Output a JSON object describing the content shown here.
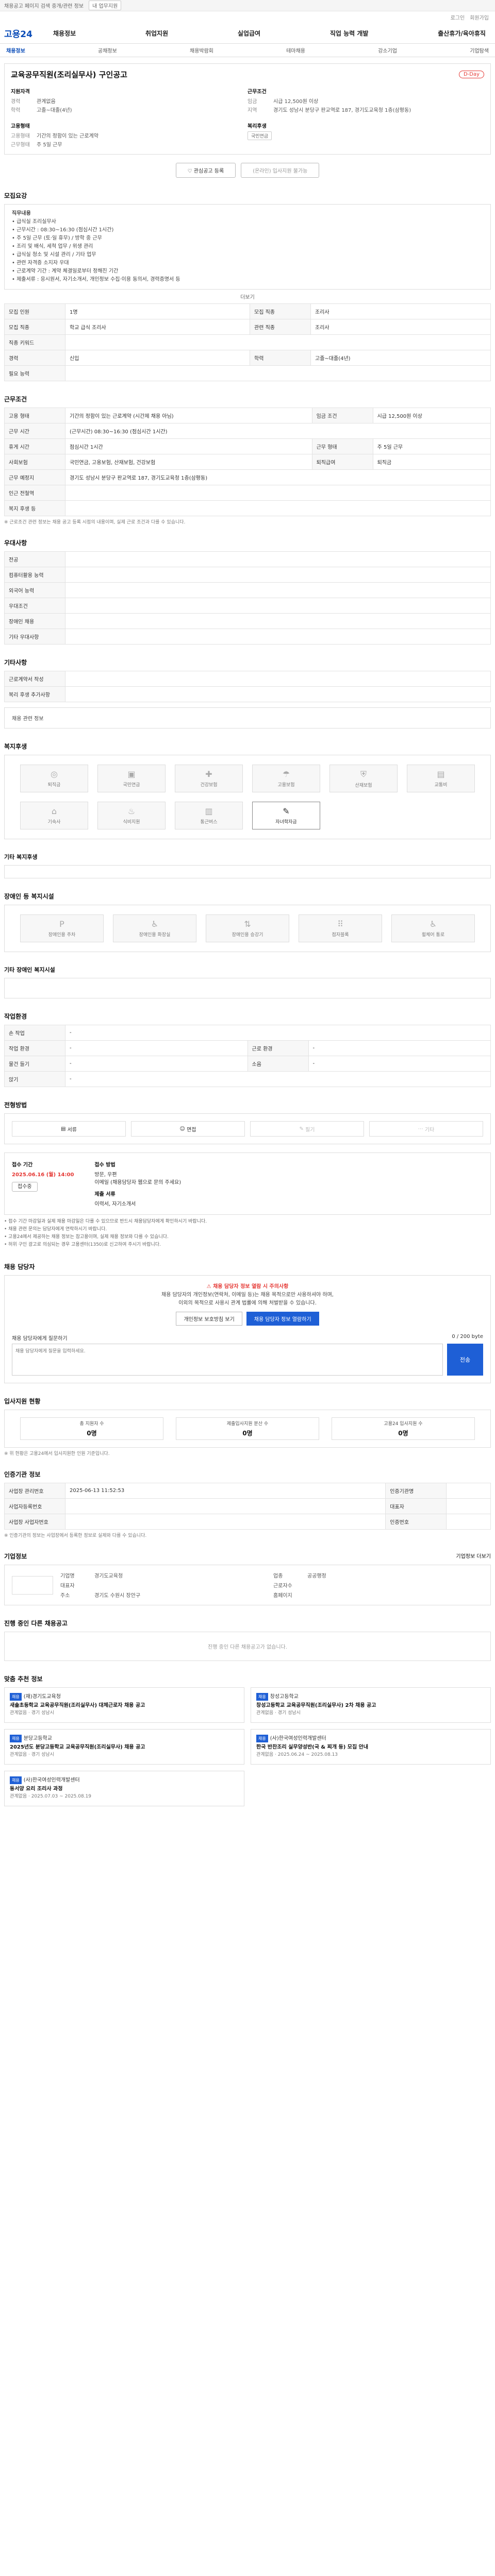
{
  "topbar": {
    "notice": "채용공고 페이지 검색 중개/관련 정보",
    "select": "내 업무지원"
  },
  "util": [
    "로그인",
    "회원가입"
  ],
  "header": {
    "logo": "고용24",
    "gnb": [
      "채용정보",
      "취업지원",
      "실업급여",
      "직업 능력 개발",
      "출산휴가/육아휴직"
    ]
  },
  "lnb": [
    "채용정보",
    "공채정보",
    "채용박람회",
    "테마채용",
    "강소기업",
    "기업탐색"
  ],
  "job": {
    "title": "교육공무직원(조리실무사) 구인공고",
    "badge": "D-Day",
    "left_title": "지원자격",
    "left": [
      [
        "경력",
        "관계없음"
      ],
      [
        "학력",
        "고졸~대졸(4년)"
      ]
    ],
    "right_title": "근무조건",
    "right": [
      [
        "임금",
        "시급 12,500원 이상"
      ],
      [
        "지역",
        "경기도 성남시 분당구 판교역로 187, 경기도교육청 1층(삼평동)"
      ]
    ],
    "left2_title": "고용형태",
    "left2": [
      [
        "고용형태",
        "기간의 정함이 있는 근로계약"
      ],
      [
        "근무형태",
        "주 5일 근무"
      ]
    ],
    "right2_title": "복리후생",
    "right2": [
      [
        "",
        "국민연금"
      ]
    ],
    "btn_scrap": "관심공고 등록",
    "btn_apply": "(온라인) 입사지원 불가능"
  },
  "jobdesc": {
    "title": "모집요강",
    "lines": [
      "직무내용",
      "• 급식실 조리실무사",
      "• 근무시간 : 08:30~16:30 (점심시간 1시간)",
      "• 주 5일 근무 (토·일 휴무) / 방학 중 근무",
      "• 조리 및 배식, 세척 업무 / 위생 관리",
      "• 급식실 청소 및 시설 관리 / 기타 업무",
      "• 관련 자격증 소지자 우대",
      "• 근로계약 기간 : 계약 체결일로부터 정해진 기간",
      "• 제출서류 : 응시원서, 자기소개서, 개인정보 수집·이용 동의서, 경력증명서 등"
    ],
    "more": "더보기"
  },
  "summary": [
    [
      "모집 인원",
      "1명",
      "모집 직종",
      "조리사"
    ],
    [
      "모집 직종",
      "학교 급식 조리사",
      "관련 직종",
      "조리사"
    ],
    [
      "직종 키워드",
      "",
      ""
    ],
    [
      "경력",
      "신입",
      "학력",
      "고졸~대졸(4년)"
    ],
    [
      "필요 능력",
      "",
      ""
    ]
  ],
  "conditions": {
    "title": "근무조건",
    "rows": [
      [
        "고용 형태",
        "기간의 정함이 있는 근로계약 (시간제 채용 아님)",
        "임금 조건",
        "시급 12,500원 이상"
      ],
      [
        "근무 시간",
        "(근무시간) 08:30~16:30 (점심시간 1시간)",
        "",
        ""
      ],
      [
        "휴게 시간",
        "점심시간 1시간",
        "근무 형태",
        "주 5일 근무"
      ],
      [
        "사회보험",
        "국민연금, 고용보험, 산재보험, 건강보험",
        "퇴직급여",
        "퇴직금"
      ],
      [
        "근무 예정지",
        "경기도 성남시 분당구 판교역로 187, 경기도교육청 1층(삼평동)",
        "",
        ""
      ],
      [
        "인근 전철역",
        "",
        ""
      ],
      [
        "복지 후생 등",
        "",
        ""
      ]
    ],
    "note": "※ 근로조건 관련 정보는 채용 공고 등록 시점의 내용이며, 실제 근로 조건과 다를 수 있습니다."
  },
  "preferred": {
    "title": "우대사항",
    "rows": [
      [
        "전공",
        ""
      ],
      [
        "컴퓨터활용 능력",
        ""
      ],
      [
        "외국어 능력",
        ""
      ],
      [
        "우대조건",
        ""
      ],
      [
        "장애인 채용",
        ""
      ],
      [
        "기타 우대사항",
        ""
      ]
    ]
  },
  "etc": {
    "title": "기타사항",
    "rows": [
      [
        "근로계약서 작성",
        "",
        ""
      ],
      [
        "복리 후생 추가사항",
        "",
        ""
      ]
    ],
    "rows2": [
      [
        "채용 관련 정보",
        ""
      ]
    ]
  },
  "welfare": {
    "title": "복지후생",
    "items": [
      "퇴직금",
      "국민연금",
      "건강보험",
      "고용보험",
      "산재보험",
      "교통비",
      "기숙사",
      "식비지원",
      "통근버스",
      "자녀학자금",
      "보건휴가",
      "육아지원"
    ],
    "active": [
      11
    ],
    "etc_title": "기타 복지후생",
    "etc": ""
  },
  "disability": {
    "title": "장애인 등 복지시설",
    "items": [
      "장애인용 주차",
      "장애인용 화장실",
      "장애인용 승강기",
      "점자블록",
      "",
      "휠체어 통로"
    ],
    "etc_title": "기타 장애인 복지시설",
    "etc": ""
  },
  "env": {
    "title": "작업환경",
    "rows": [
      [
        "손 작업",
        "-",
        "",
        ""
      ],
      [
        "작업 환경",
        "-",
        "근로 환경",
        "-"
      ],
      [
        "물건 들기",
        "-",
        "소음",
        "-"
      ],
      [
        "앉기",
        "-",
        "",
        ""
      ]
    ]
  },
  "channel": {
    "title": "전형방법",
    "items": [
      "서류",
      "면접",
      "필기",
      "기타"
    ],
    "active": [
      0,
      1
    ]
  },
  "process": {
    "title": "접수 기간",
    "period": "2025.06.16 (월) 14:00",
    "status": "접수중",
    "close_title": "접수 방법",
    "close": [
      "방문, 우편",
      "이메일 (채용담당자 웹으로 문의 주세요)"
    ],
    "docs_title": "제출 서류",
    "docs": "이력서, 자기소개서"
  },
  "bullets": [
    "• 접수 기간 마감일과 실제 채용 마감일은 다를 수 있으므로 반드시 채용담당자에게 확인하시기 바랍니다.",
    "• 채용 관련 문의는 담당자에게 연락하시기 바랍니다.",
    "• 고용24에서 제공하는 채용 정보는 참고용이며, 실제 채용 정보와 다를 수 있습니다.",
    "• 허위 구인 광고로 의심되는 경우 고용센터(1350)로 신고하여 주시기 바랍니다."
  ],
  "contact": {
    "title": "채용 담당자",
    "alert1": "채용 담당자 정보 열람 시 주의사항",
    "alert2": "채용 담당자의 개인정보(연락처, 이메일 등)는 채용 목적으로만 사용하셔야 하며,",
    "alert3": "이외의 목적으로 사용시 관계 법률에 의해 처벌받을 수 있습니다.",
    "btn1": "개인정보 보호방침 보기",
    "btn2": "채용 담당자 정보 열람하기",
    "qa_label": "채용 담당자에게 질문하기",
    "qa_count": "0 / 200 byte",
    "qa_placeholder": "채용 담당자에게 질문을 입력하세요.",
    "send": "전송"
  },
  "stats": {
    "title": "입사지원 현황",
    "items": [
      [
        "총 지원자 수",
        "0명"
      ],
      [
        "제출입사지원 분산 수",
        "0명"
      ],
      [
        "고용24 입사지원 수",
        "0명"
      ]
    ],
    "note": "※ 위 현황은 고용24에서 입사지원한 인원 기준입니다."
  },
  "company": {
    "title": "인증기관 정보",
    "rows": [
      [
        "사업장 관리번호",
        "2025-06-13 11:52:53",
        "인증기관명",
        ""
      ],
      [
        "사업자등록번호",
        "",
        "대표자",
        ""
      ],
      [
        "사업장 사업자번호",
        "",
        "인증번호",
        ""
      ]
    ],
    "note": "※ 인증기관의 정보는 사업장에서 등록한 정보로 실제와 다를 수 있습니다."
  },
  "enterprise": {
    "title": "기업정보",
    "more": "기업정보 더보기",
    "name": "",
    "meta": [
      [
        "기업명",
        "경기도교육청",
        "업종",
        "공공행정"
      ],
      [
        "대표자",
        "",
        "근로자수",
        ""
      ],
      [
        "주소",
        "경기도 수원시 장안구",
        "홈페이지",
        ""
      ]
    ]
  },
  "similar": {
    "title": "진행 중인 다른 채용공고",
    "empty": "진행 중인 다른 채용공고가 없습니다."
  },
  "recommend": {
    "title": "맞춤 추천 정보",
    "items": [
      {
        "tag": "채용",
        "org": "(재)경기도교육청",
        "t": "새솔초등학교 교육공무직원(조리실무사) 대체근로자 채용 공고",
        "s": "관계없음 · 경기 성남시",
        "d": "D-3"
      },
      {
        "tag": "채용",
        "org": "창성고등학교",
        "t": "창성고등학교 교육공무직원(조리실무사) 2차 채용 공고",
        "s": "관계없음 · 경기 성남시",
        "d": "D-5"
      },
      {
        "tag": "채용",
        "org": "분당고등학교",
        "t": "2025년도 분당고등학교 교육공무직원(조리실무사) 채용 공고",
        "s": "관계없음 · 경기 성남시",
        "d": "D-7"
      },
      {
        "tag": "채용",
        "org": "(사)한국여성인력개발센터",
        "t": "한국 반찬조리 실무양성반(국 & 찌개 등) 모집 안내",
        "s": "관계없음 · 2025.06.24 ~ 2025.08.13",
        "d": ""
      },
      {
        "tag": "채용",
        "org": "(사)한국여성인력개발센터",
        "t": "동서양 요리 조리사 과정",
        "s": "관계없음 · 2025.07.03 ~ 2025.08.19",
        "d": ""
      }
    ]
  }
}
